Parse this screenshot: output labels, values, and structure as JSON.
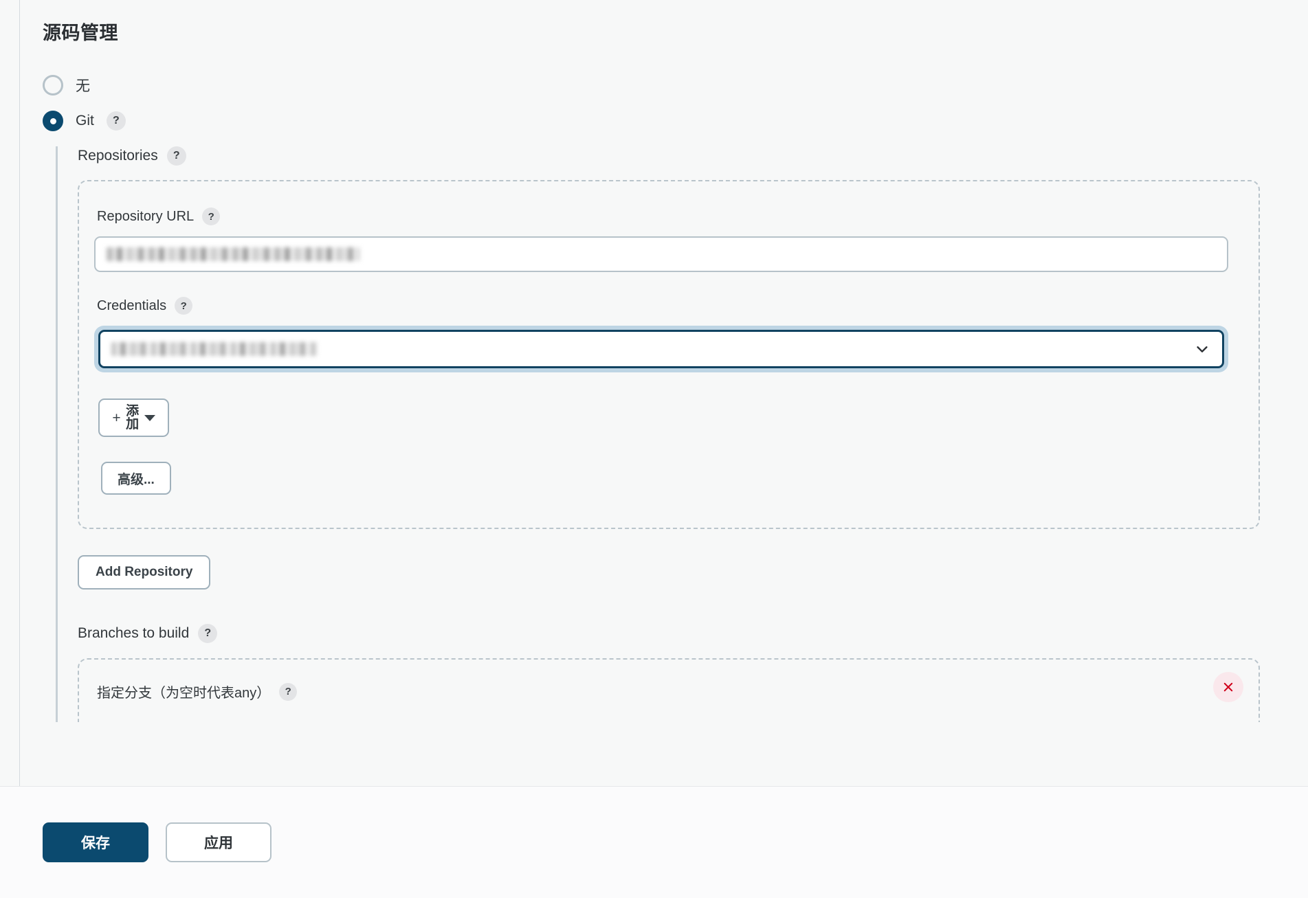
{
  "page": {
    "title": "源码管理"
  },
  "scm_options": [
    {
      "label": "无",
      "selected": false,
      "has_help": false
    },
    {
      "label": "Git",
      "selected": true,
      "has_help": true
    }
  ],
  "git": {
    "repositories_label": "Repositories",
    "repository": {
      "url_label": "Repository URL",
      "url_value": "",
      "credentials_label": "Credentials",
      "credentials_value": "",
      "add_button_label": "添加",
      "add_button_icon": "plus-icon",
      "add_button_caret": "caret-down-icon",
      "advanced_button_label": "高级..."
    },
    "add_repository_label": "Add Repository",
    "branches_label": "Branches to build",
    "branch_specifier_label": "指定分支（为空时代表any）",
    "delete_icon": "close-icon"
  },
  "footer": {
    "save_label": "保存",
    "apply_label": "应用"
  },
  "help_glyph": "?",
  "colors": {
    "accent": "#0b4a6f",
    "focus_ring": "#bed5e4",
    "focus_border": "#114361",
    "danger": "#d0021b",
    "danger_bg": "#fae8ec",
    "page_bg": "#f7f8f8",
    "dashed_border": "#b9c4cb"
  }
}
